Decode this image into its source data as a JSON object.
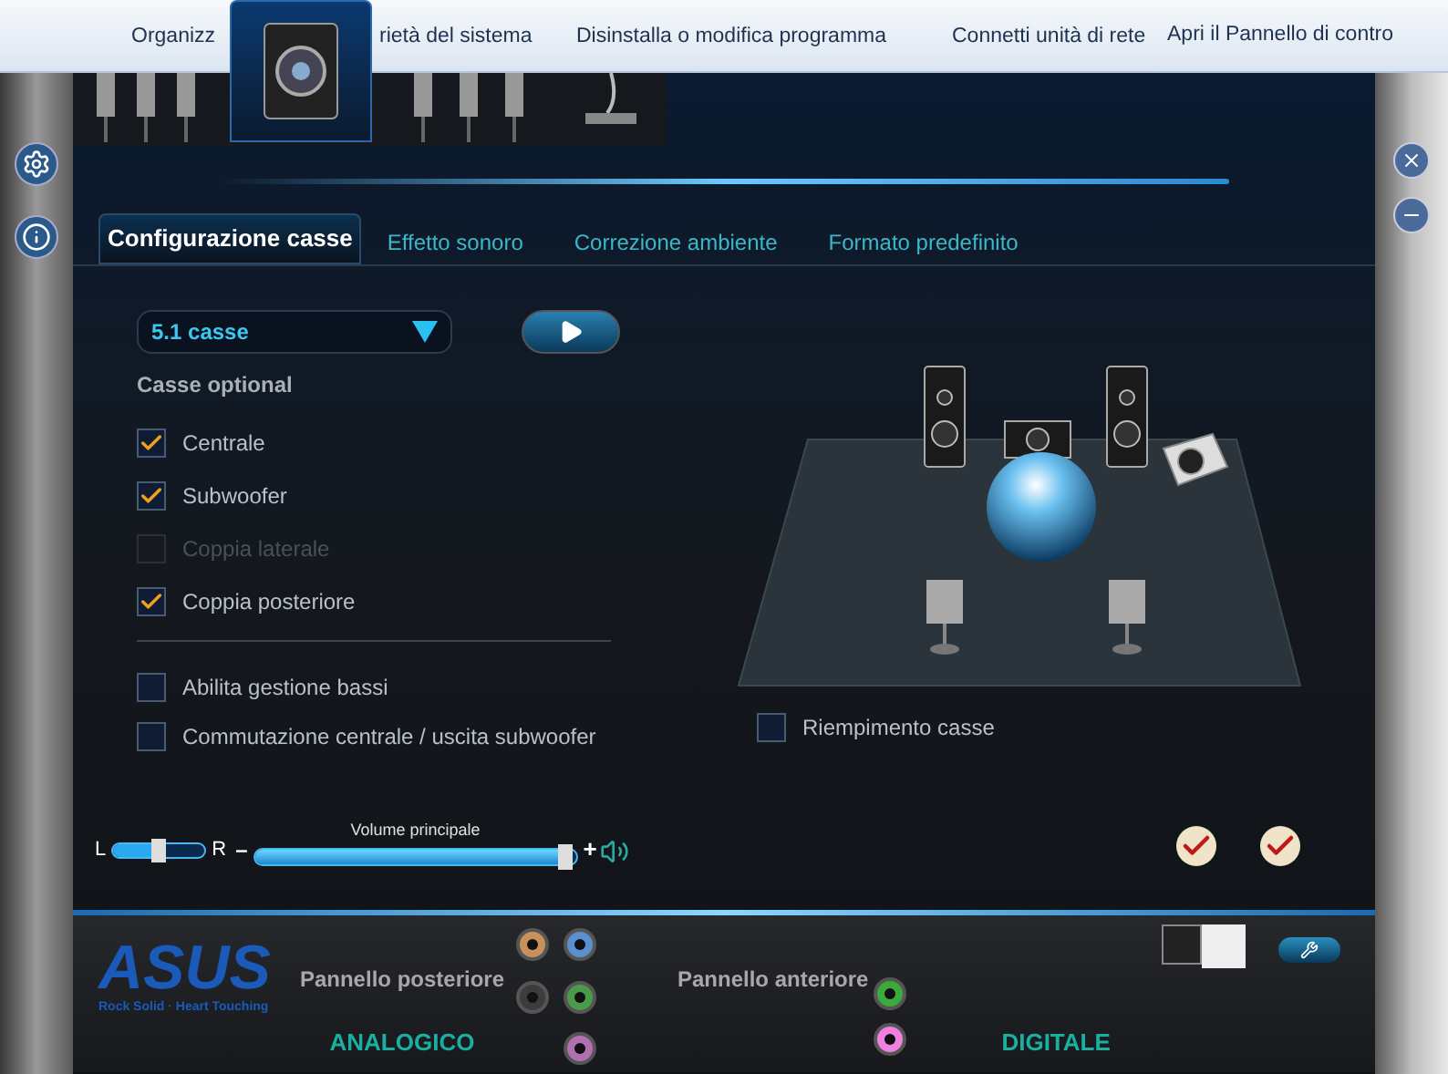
{
  "explorer_bar": {
    "items": [
      "Organizz",
      "rietà del sistema",
      "Disinstalla o modifica programma",
      "Connetti unità di rete",
      "Apri il Pannello di contro"
    ]
  },
  "tabs": [
    {
      "label": "Configurazione casse",
      "selected": true
    },
    {
      "label": "Effetto sonoro",
      "selected": false
    },
    {
      "label": "Correzione ambiente",
      "selected": false
    },
    {
      "label": "Formato predefinito",
      "selected": false
    }
  ],
  "speaker_config": {
    "value": "5.1 casse"
  },
  "optional_label": "Casse optional",
  "optional_speakers": [
    {
      "label": "Centrale",
      "checked": true,
      "disabled": false
    },
    {
      "label": "Subwoofer",
      "checked": true,
      "disabled": false
    },
    {
      "label": "Coppia laterale",
      "checked": false,
      "disabled": true
    },
    {
      "label": "Coppia posteriore",
      "checked": true,
      "disabled": false
    }
  ],
  "options": [
    {
      "label": "Abilita gestione bassi",
      "checked": false
    },
    {
      "label": "Commutazione centrale / uscita subwoofer",
      "checked": false
    }
  ],
  "fill_option": {
    "label": "Riempimento casse",
    "checked": false
  },
  "balance": {
    "left": "L",
    "right": "R",
    "level": 0.5
  },
  "volume": {
    "label": "Volume principale",
    "minus": "–",
    "plus": "+",
    "level": 0.97
  },
  "logo": {
    "name": "ASUS",
    "tagline": "Rock Solid · Heart Touching"
  },
  "rear_panel": {
    "label": "Pannello posteriore",
    "jacks": [
      {
        "color": "#c8905a"
      },
      {
        "color": "#5a90d0"
      },
      {
        "color": "#3c3c3c"
      },
      {
        "color": "#4a9a4a"
      },
      {
        "color": "#b070b0"
      }
    ]
  },
  "front_panel": {
    "label": "Pannello anteriore",
    "jacks": [
      {
        "color": "#3aaa3a"
      },
      {
        "color": "#f080e0"
      }
    ]
  },
  "analog_label": "ANALOGICO",
  "digital_label": "DIGITALE"
}
